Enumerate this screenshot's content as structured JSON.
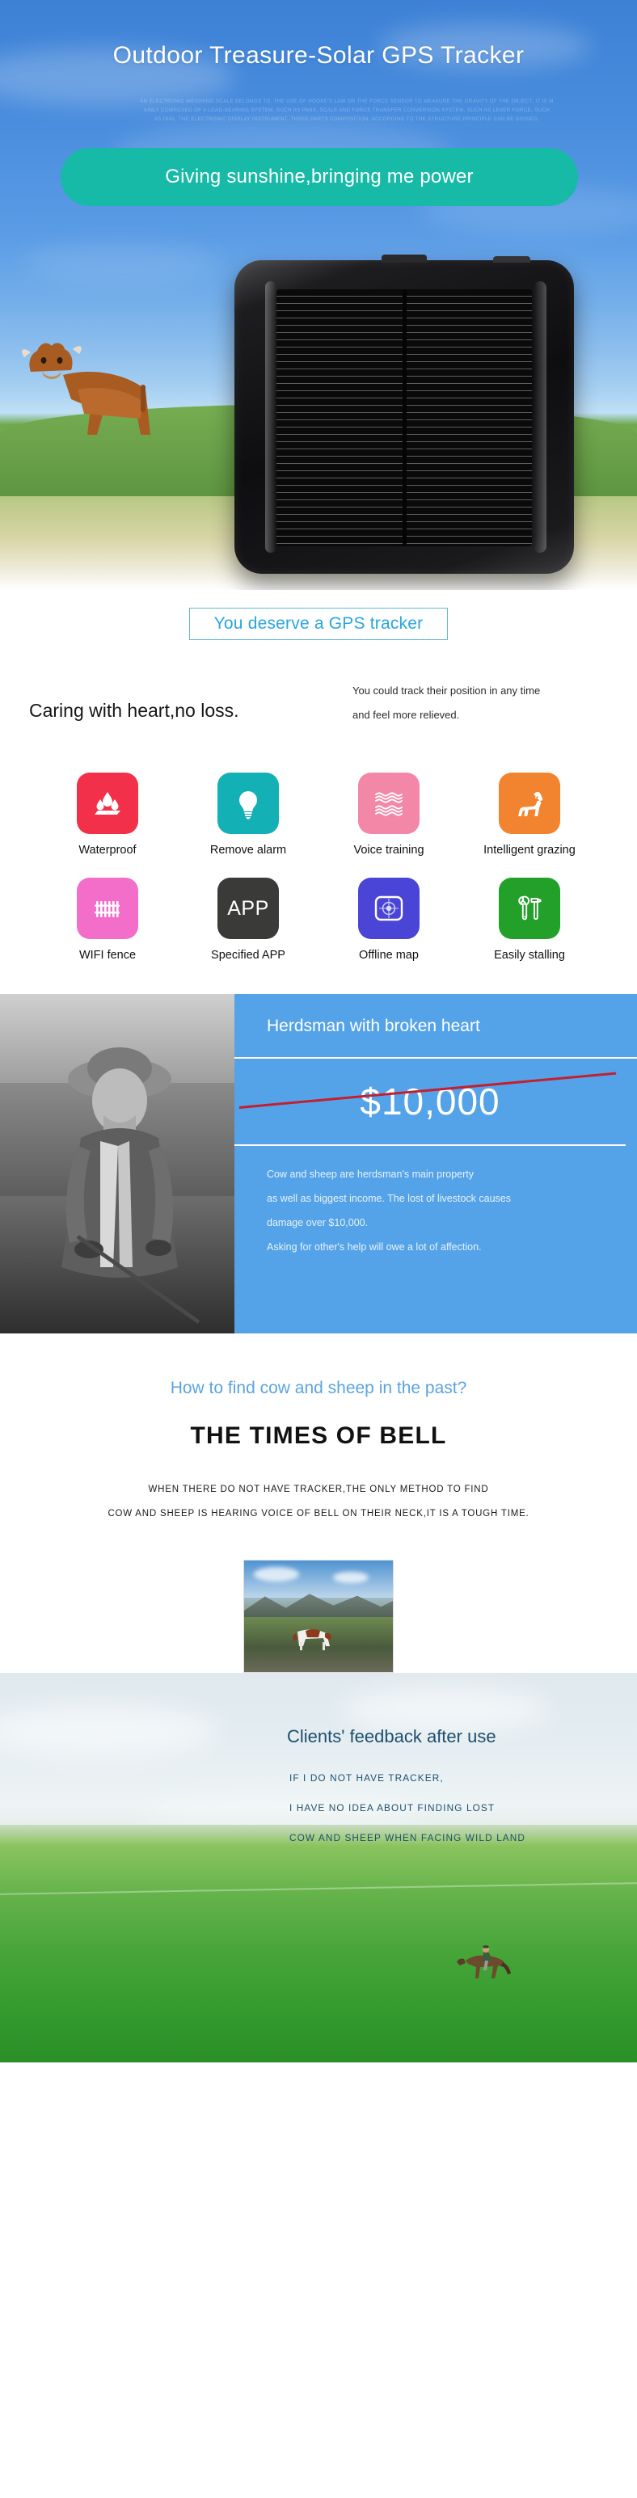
{
  "hero": {
    "title": "Outdoor Treasure-Solar GPS Tracker",
    "fineprint": "AN ELECTRONIC WEIGHING SCALE BELONGS TO, THE USE OF HOOKE'S LAW OR THE FORCE SENSOR TO MEASURE THE GRAVITY OF THE OBJECT, IT IS M\nAINLY COMPOSED OF A LOAD-BEARING SYSTEM, SUCH AS PANS, SCALE AND FORCE TRANSFER CONVERSION SYSTEM, SUCH AS LEVER FORCE, SUCH\nAS DIAL, THE ELECTRONIC DISPLAY INSTRUMENT, THREE PARTS COMPOSITION, ACCORDING TO THE STRUCTURE PRINCIPLE CAN BE DIVIDED.",
    "cta": "Giving sunshine,bringing me power",
    "device_name": "solar-gps-tracker-device",
    "accent_green": "#17b9a7",
    "sky_blue": "#4a8ede"
  },
  "deserve": {
    "label": "You deserve a GPS tracker",
    "border_color": "#63b8d6",
    "text_color": "#29a6e0"
  },
  "caring": {
    "headline": "Caring with heart,no loss.",
    "body_line1": "You could track their position in any time",
    "body_line2": "and feel more relieved."
  },
  "features": [
    {
      "label": "Waterproof",
      "icon": "water-drops-icon",
      "color": "#f23049"
    },
    {
      "label": "Remove alarm",
      "icon": "lightbulb-icon",
      "color": "#13b0b5"
    },
    {
      "label": "Voice training",
      "icon": "sound-waves-icon",
      "color": "#f287a8"
    },
    {
      "label": "Intelligent grazing",
      "icon": "dog-icon",
      "color": "#f28430"
    },
    {
      "label": "WIFI fence",
      "icon": "fence-icon",
      "color": "#f26ec8"
    },
    {
      "label": "Specified APP",
      "icon": "app-text-icon",
      "color": "#3a3a38",
      "text": "APP"
    },
    {
      "label": "Offline map",
      "icon": "map-target-icon",
      "color": "#4a45d6"
    },
    {
      "label": "Easily stalling",
      "icon": "tools-icon",
      "color": "#22a02a"
    }
  ],
  "herdsman": {
    "photo_name": "herdsman-portrait-photo",
    "title": "Herdsman with broken heart",
    "price": "$10,000",
    "strike_color": "#c22030",
    "body_line1": "Cow and sheep are herdsman's main property",
    "body_line2": "as well as biggest income. The lost of livestock causes",
    "body_line3": "damage over $10,000.",
    "body_line4": "Asking for other's help will owe a lot of affection.",
    "background": "#54a3e8"
  },
  "bell": {
    "question": "How to find cow and sheep in the past?",
    "heading": "THE TIMES OF BELL",
    "para_line1": "WHEN THERE DO NOT HAVE TRACKER,THE ONLY METHOD TO FIND",
    "para_line2": "COW AND SHEEP IS HEARING VOICE OF BELL ON THEIR NECK,IT IS A TOUGH TIME.",
    "photo_name": "cow-in-mountain-pasture-photo",
    "question_color": "#5ba4e0"
  },
  "feedback": {
    "title": "Clients' feedback after use",
    "line1": "IF I DO NOT HAVE TRACKER,",
    "line2": "I HAVE NO IDEA ABOUT FINDING LOST",
    "line3": "COW AND SHEEP WHEN FACING WILD LAND",
    "photo_name": "horse-rider-on-grassland-photo",
    "text_color": "#1d4f6e"
  }
}
